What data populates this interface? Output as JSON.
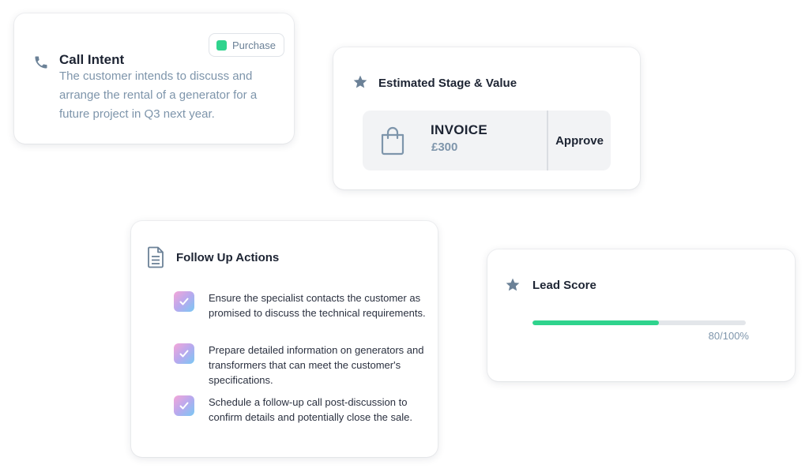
{
  "call_intent": {
    "title": "Call Intent",
    "badge_label": "Purchase",
    "badge_color": "#2fd38d",
    "icon": "phone-icon",
    "description": "The customer intends to discuss and arrange the rental of a generator for a future project  in Q3 next year."
  },
  "stage": {
    "title": "Estimated Stage & Value",
    "icon": "star-icon",
    "stage_name": "INVOICE",
    "value": "£300",
    "stage_icon": "shopping-bag-icon",
    "approve_label": "Approve"
  },
  "follow_up": {
    "title": "Follow Up Actions",
    "icon": "document-icon",
    "items": [
      {
        "text": "Ensure the specialist contacts the customer as promised to discuss the technical requirements.",
        "checked": true
      },
      {
        "text": "Prepare detailed information on generators and transformers that can meet the customer's specifications.",
        "checked": true
      },
      {
        "text": "Schedule a follow-up call post-discussion to confirm details and potentially close the sale.",
        "checked": true
      }
    ]
  },
  "lead_score": {
    "title": "Lead Score",
    "icon": "star-icon",
    "score_label": "80/100%",
    "score_value": 80,
    "score_max": 100,
    "bar_color": "#2fd38d"
  }
}
